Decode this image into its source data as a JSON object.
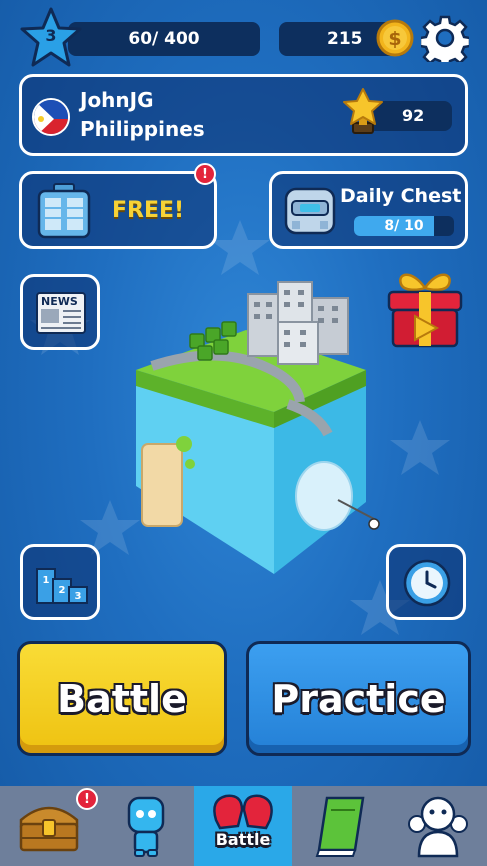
{
  "header": {
    "level": "3",
    "xp_text": "60/ 400",
    "coins": "215"
  },
  "profile": {
    "name": "JohnJG",
    "country": "Philippines",
    "trophies": "92"
  },
  "offers": {
    "free_label": "FREE!",
    "free_badge": "!",
    "daily_chest_label": "Daily Chest",
    "daily_chest_progress_text": "8/ 10",
    "daily_chest_progress": 0.8
  },
  "news_label": "NEWS",
  "podium_numbers": [
    "1",
    "2",
    "3"
  ],
  "buttons": {
    "battle": "Battle",
    "practice": "Practice"
  },
  "nav": {
    "items": [
      {
        "name": "chest",
        "label": ""
      },
      {
        "name": "characters",
        "label": ""
      },
      {
        "name": "battle",
        "label": "Battle"
      },
      {
        "name": "book",
        "label": ""
      },
      {
        "name": "social",
        "label": ""
      }
    ],
    "chest_badge": "!"
  },
  "colors": {
    "battle_button": "#f5cf1b",
    "practice_button": "#2f8fe0",
    "nav_active": "#2aa8e8",
    "badge": "#e3243b"
  }
}
